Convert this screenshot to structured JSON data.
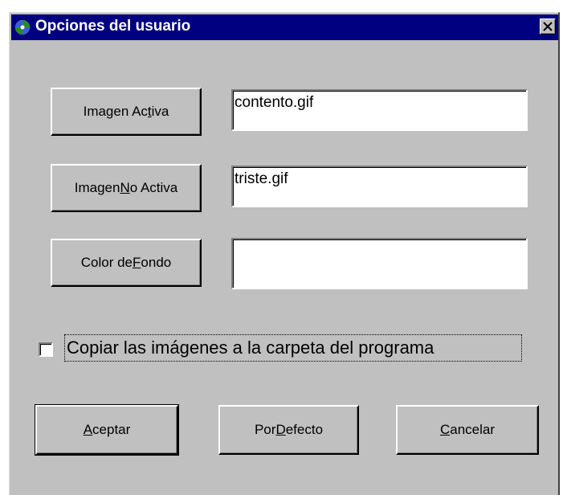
{
  "window": {
    "title": "Opciones del usuario",
    "icon": "app-icon",
    "close_icon": "close-icon"
  },
  "rows": [
    {
      "button": {
        "pre": "Imagen Ac",
        "accel": "t",
        "post": "iva"
      },
      "value": "contento.gif"
    },
    {
      "button": {
        "pre": "Imagen ",
        "accel": "N",
        "post": "o Activa"
      },
      "value": "triste.gif"
    },
    {
      "button": {
        "pre": "Color de ",
        "accel": "F",
        "post": "ondo"
      },
      "value": ""
    }
  ],
  "checkbox": {
    "label": "Copiar las imágenes a la carpeta del programa",
    "checked": false
  },
  "footer": {
    "accept": {
      "pre": "",
      "accel": "A",
      "post": "ceptar"
    },
    "default": {
      "pre": "Por ",
      "accel": "D",
      "post": "efecto"
    },
    "cancel": {
      "pre": "",
      "accel": "C",
      "post": "ancelar"
    }
  },
  "colors": {
    "titlebar": "#000080",
    "face": "#c0c0c0"
  }
}
